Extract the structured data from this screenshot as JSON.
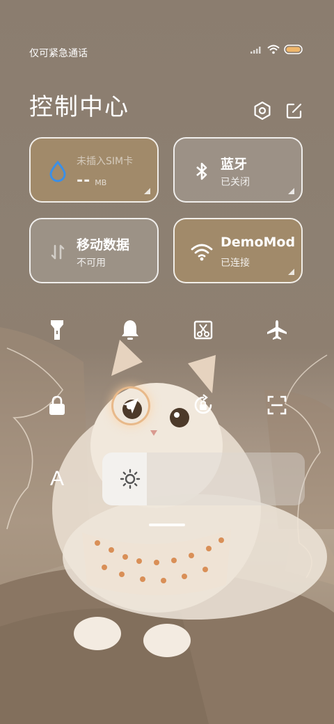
{
  "status": {
    "carrier_text": "仅可紧急通话"
  },
  "header": {
    "title": "控制中心"
  },
  "tiles": {
    "data_usage": {
      "line1": "未插入SIM卡",
      "value": "--",
      "unit": "MB"
    },
    "bluetooth": {
      "label": "蓝牙",
      "sub": "已关闭"
    },
    "mobile_data": {
      "label": "移动数据",
      "sub": "不可用"
    },
    "wifi": {
      "label": "DemoMod",
      "sub": "已连接"
    }
  },
  "quick_toggles": {
    "row1": [
      "flashlight-icon",
      "bell-icon",
      "screenshot-icon",
      "airplane-icon"
    ],
    "row2": [
      "lock-icon",
      "location-icon",
      "rotation-lock-icon",
      "scan-icon"
    ]
  },
  "font_button": {
    "label": "A"
  },
  "brightness": {
    "level": 0.22
  },
  "colors": {
    "accent_active": "#a58c69",
    "drop_blue": "#3b8fe6",
    "location_ring": "#e8b98a"
  }
}
